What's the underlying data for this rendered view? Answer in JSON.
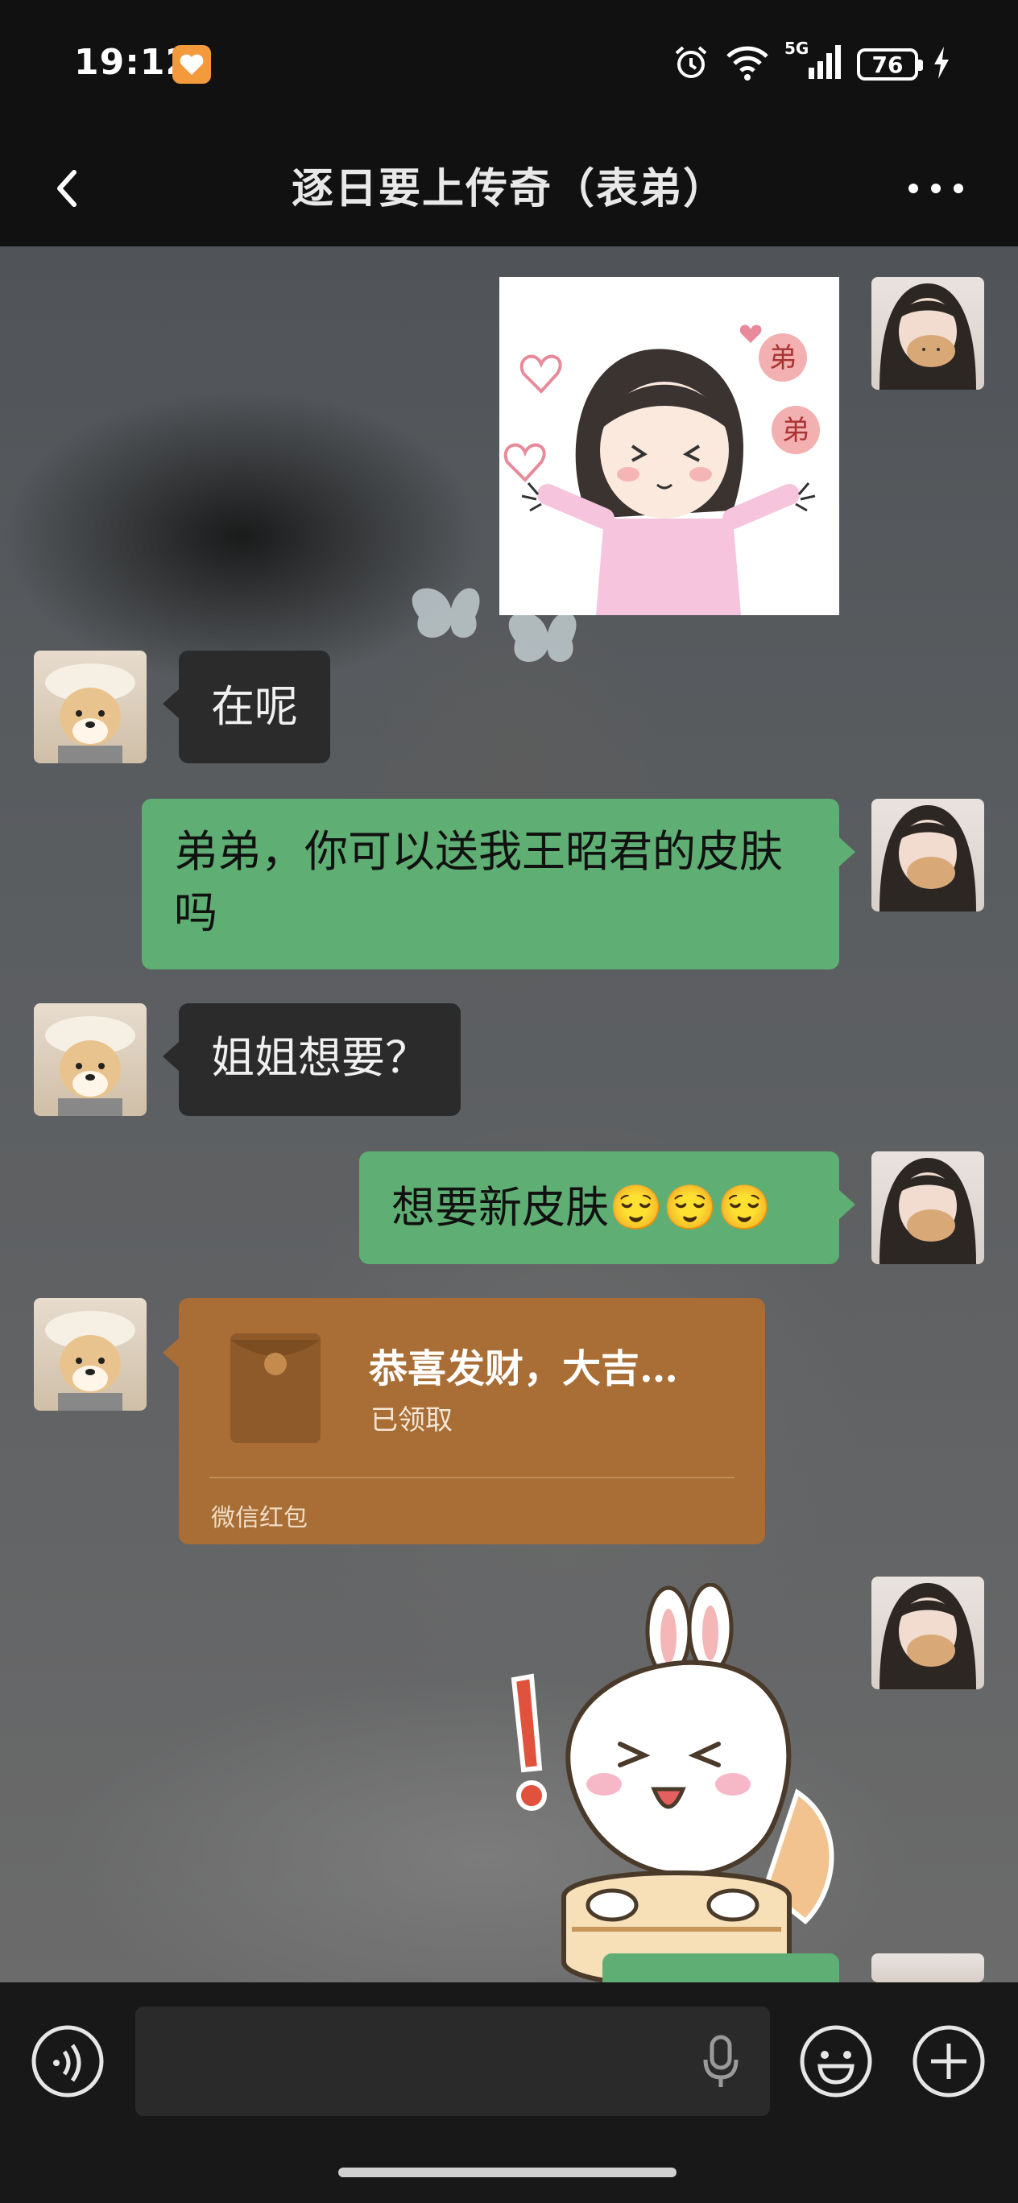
{
  "status_bar": {
    "time": "19:12",
    "battery": "76",
    "network": "5G"
  },
  "header": {
    "title": "逐日要上传奇（表弟）"
  },
  "messages": [
    {
      "side": "out",
      "type": "sticker",
      "sticker_text": [
        "弟",
        "弟"
      ]
    },
    {
      "side": "in",
      "type": "text",
      "text": "在呢"
    },
    {
      "side": "out",
      "type": "text",
      "text": "弟弟，你可以送我王昭君的皮肤吗"
    },
    {
      "side": "in",
      "type": "text",
      "text": "姐姐想要？"
    },
    {
      "side": "out",
      "type": "text",
      "text": "想要新皮肤😌😌😌"
    },
    {
      "side": "in",
      "type": "red_packet",
      "title": "恭喜发财，大吉…",
      "status": "已领取",
      "footer": "微信红包"
    },
    {
      "side": "out",
      "type": "sticker"
    }
  ],
  "colors": {
    "outgoing_bubble": "#5fae73",
    "incoming_bubble": "#2b2b2b",
    "red_packet": "#a86e36"
  },
  "icons": [
    "back-icon",
    "more-icon",
    "voice-icon",
    "microphone-icon",
    "emoji-icon",
    "plus-icon"
  ]
}
